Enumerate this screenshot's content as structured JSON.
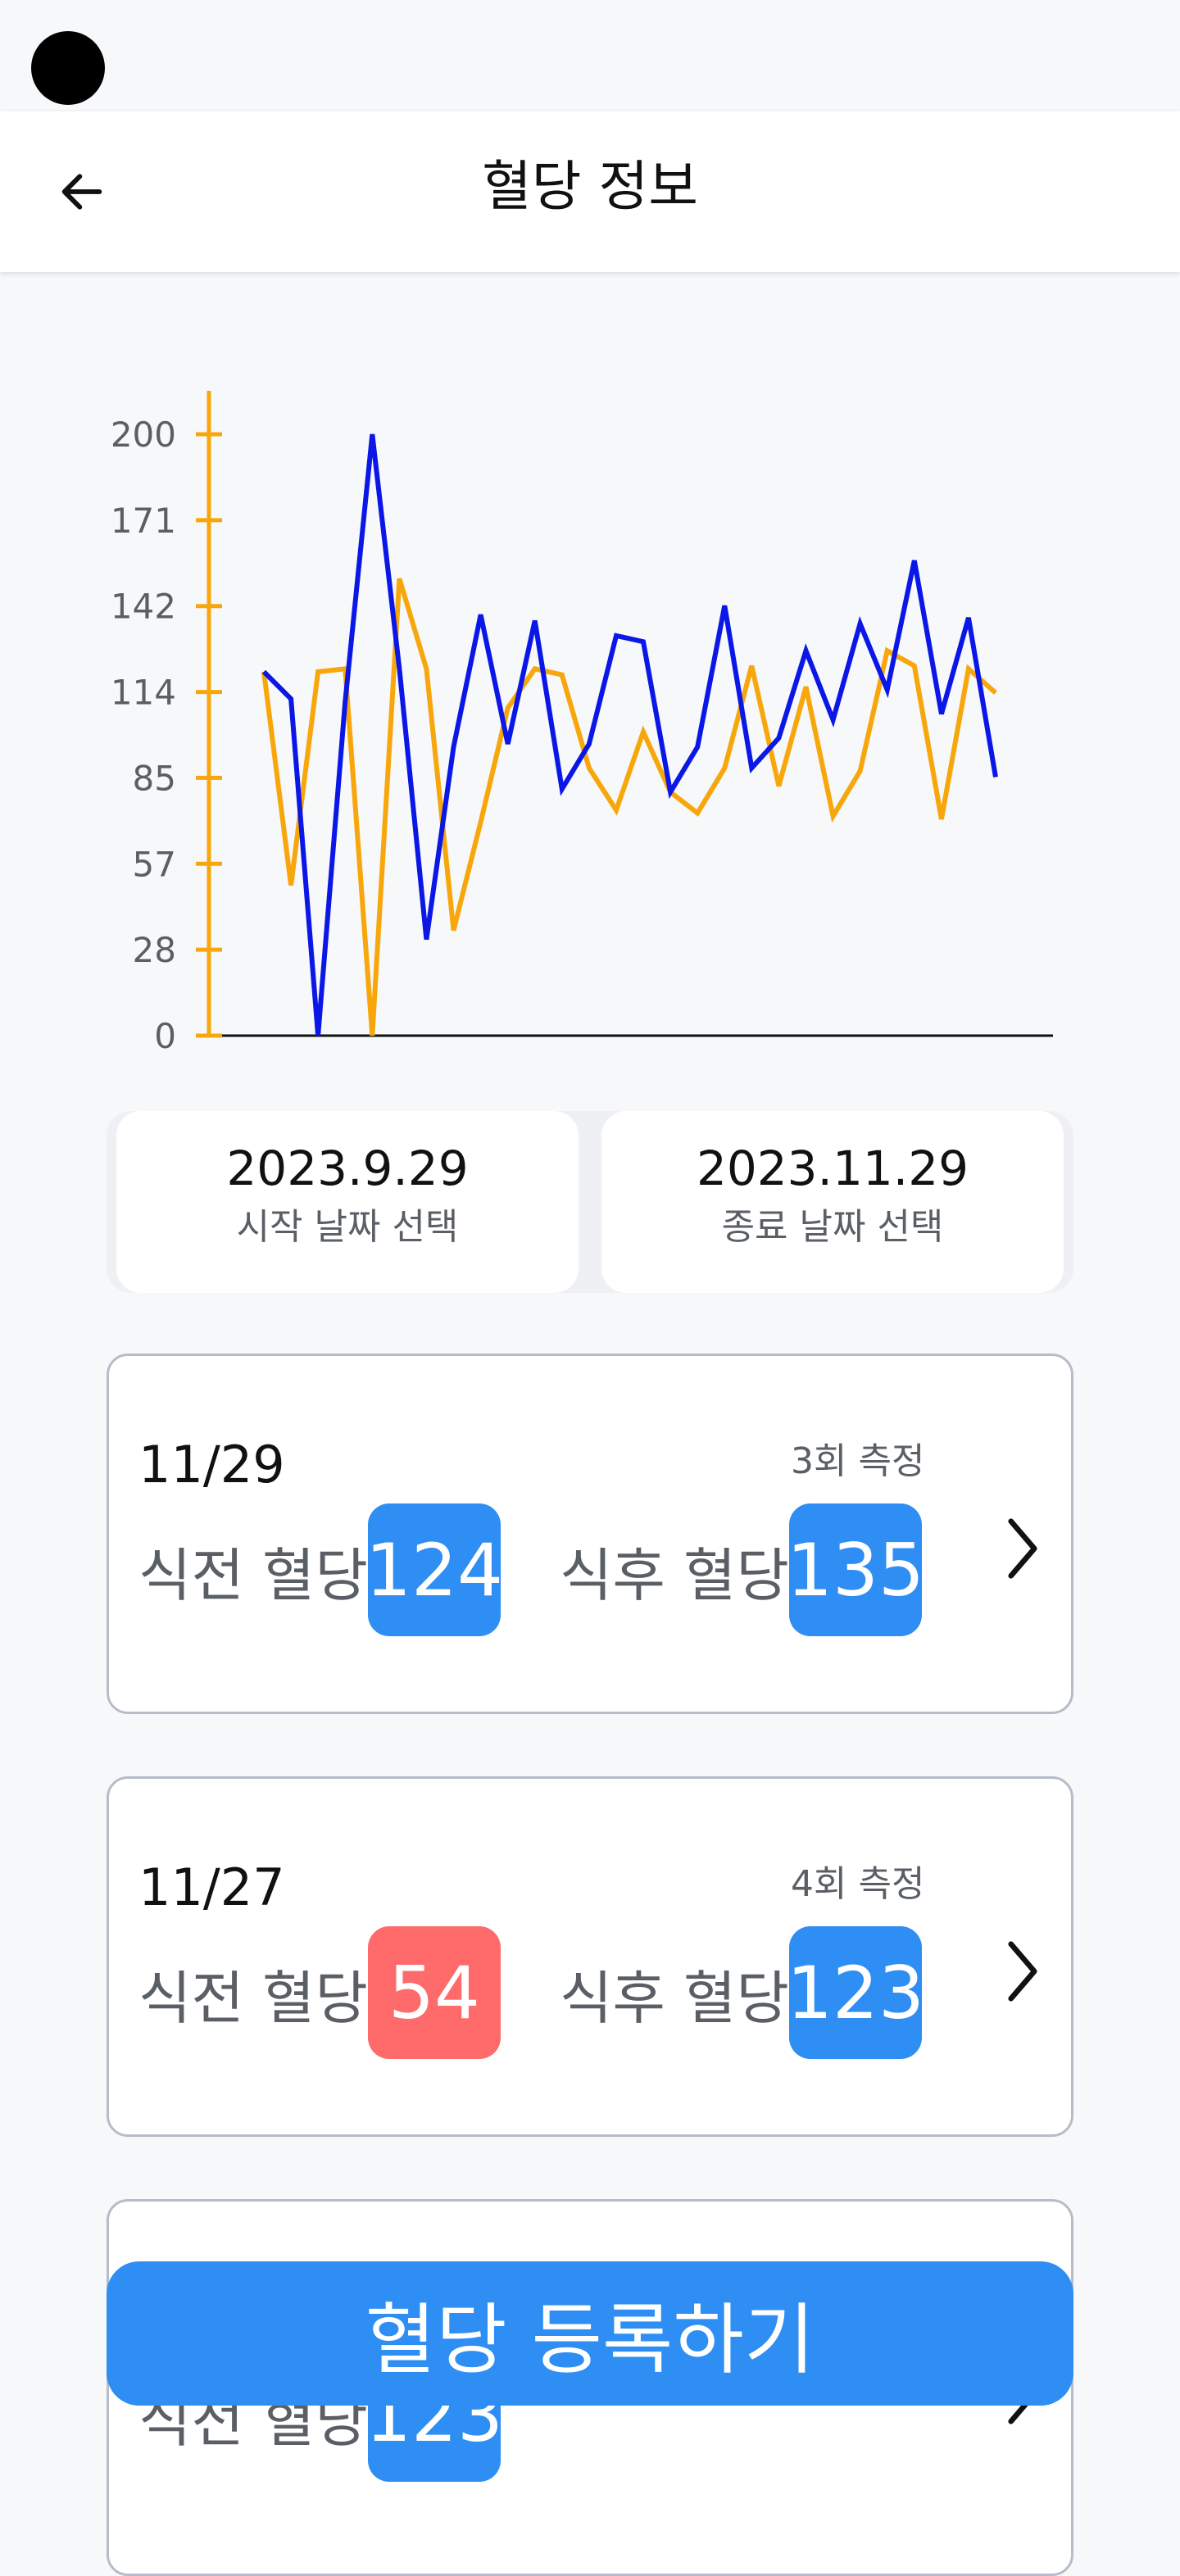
{
  "app_bar": {
    "title": "혈당 정보",
    "back_icon": "arrow-left-icon"
  },
  "colors": {
    "badge_normal": "#2e8ef3",
    "badge_low": "#ff6b6b",
    "series_pre": "#f7a70c",
    "series_post": "#0a17e6",
    "button": "#2e8ef3"
  },
  "chart_data": {
    "type": "line",
    "ylim": [
      0,
      200
    ],
    "y_ticks": [
      "0",
      "28",
      "57",
      "85",
      "114",
      "142",
      "171",
      "200"
    ],
    "series": [
      {
        "color": "#f7a70c",
        "values": [
          121,
          50,
          121,
          122,
          0,
          152,
          122,
          35,
          71,
          109,
          122,
          120,
          89,
          75,
          101,
          81,
          74,
          89,
          123,
          83,
          116,
          73,
          88,
          128,
          123,
          72,
          122,
          114
        ]
      },
      {
        "color": "#0a17e6",
        "values": [
          121,
          112,
          0,
          111,
          200,
          122,
          32,
          96,
          140,
          97,
          138,
          82,
          97,
          133,
          131,
          81,
          96,
          143,
          89,
          99,
          128,
          105,
          137,
          115,
          158,
          107,
          139,
          86
        ]
      }
    ]
  },
  "date_range": {
    "start_value": "2023.9.29",
    "start_label": "시작 날짜 선택",
    "end_value": "2023.11.29",
    "end_label": "종료 날짜 선택"
  },
  "records": [
    {
      "date": "11/29",
      "count": "3회 측정",
      "pre_label": "식전 혈당",
      "pre_value": "124",
      "pre_color": "#2e8ef3",
      "post_label": "식후 혈당",
      "post_value": "135",
      "post_color": "#2e8ef3"
    },
    {
      "date": "11/27",
      "count": "4회 측정",
      "pre_label": "식전 혈당",
      "pre_value": "54",
      "pre_color": "#ff6b6b",
      "post_label": "식후 혈당",
      "post_value": "123",
      "post_color": "#2e8ef3"
    },
    {
      "date": "",
      "count": "",
      "pre_label": "식전 혈당",
      "pre_value": "123",
      "pre_color": "#2e8ef3",
      "post_label": "",
      "post_value": "",
      "post_color": "#2e8ef3"
    }
  ],
  "register_button": "혈당 등록하기"
}
